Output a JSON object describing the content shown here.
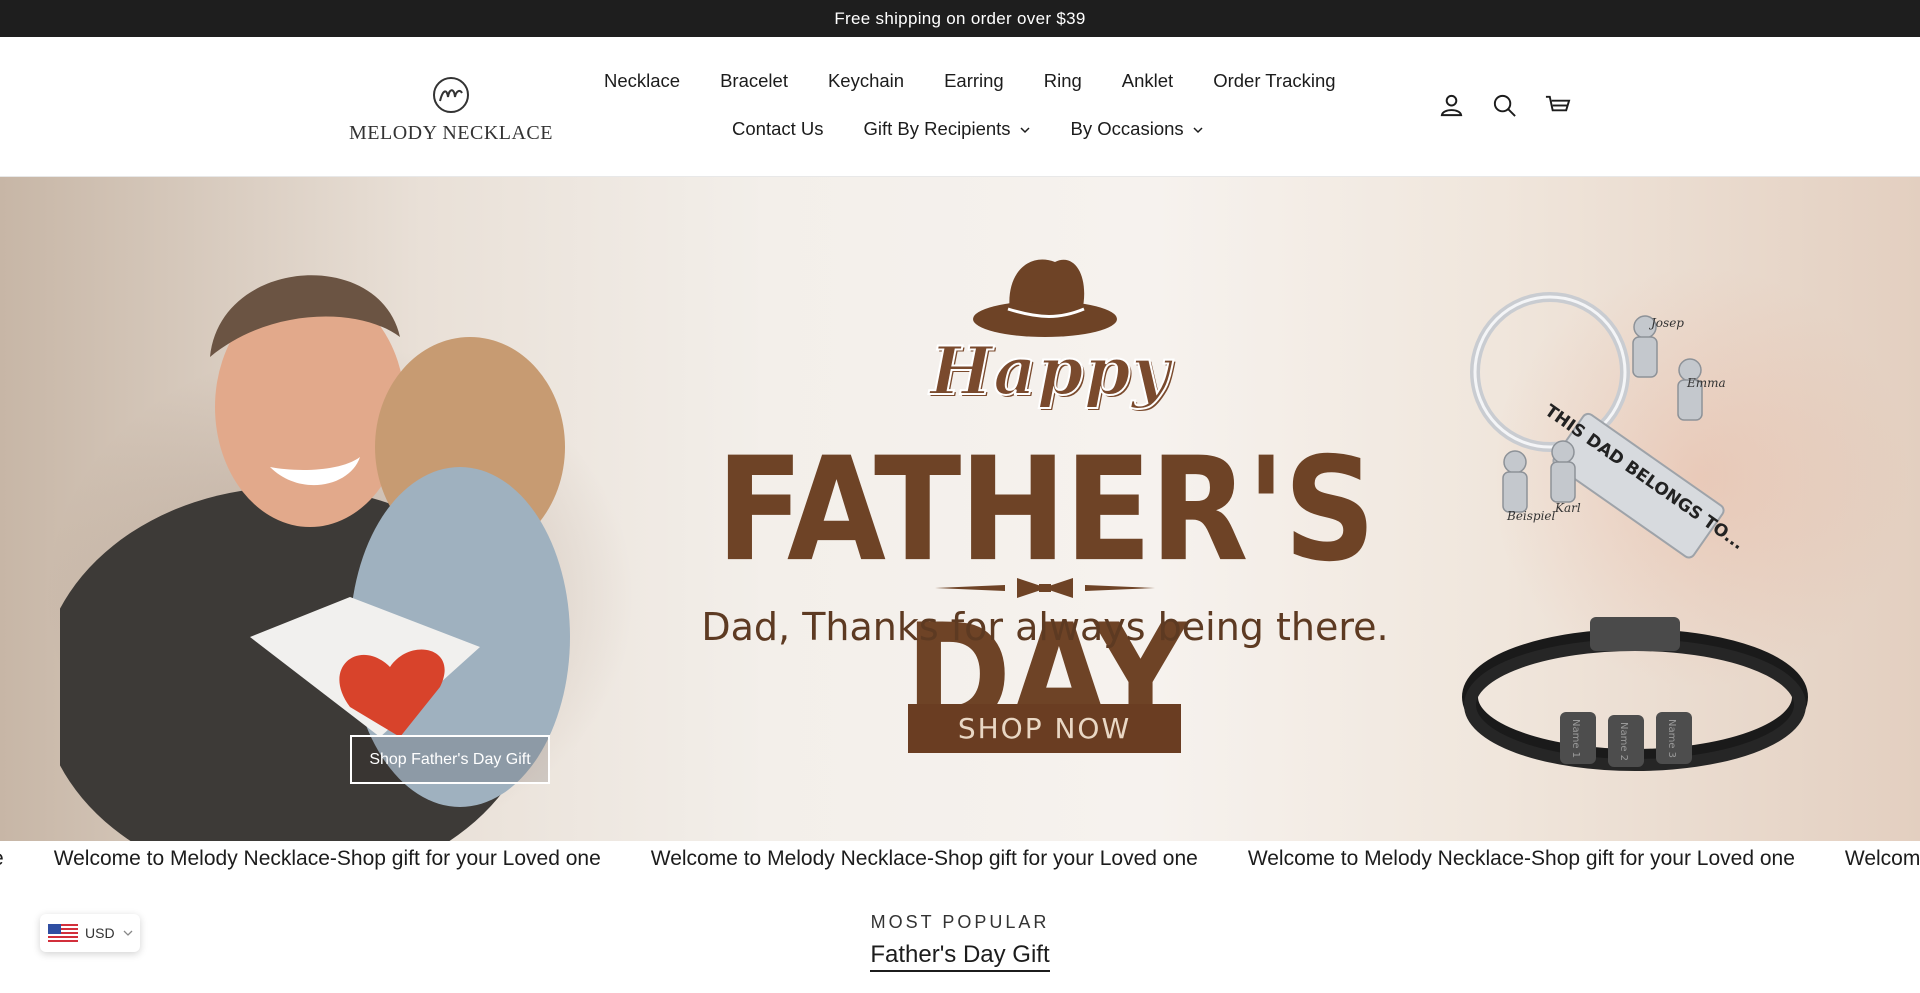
{
  "announcement": {
    "text": "Free shipping on order over $39"
  },
  "brand": {
    "name": "MELODY NECKLACE"
  },
  "nav": {
    "row1": [
      "Necklace",
      "Bracelet",
      "Keychain",
      "Earring",
      "Ring",
      "Anklet",
      "Order Tracking"
    ],
    "row2": [
      {
        "label": "Contact Us",
        "dropdown": false
      },
      {
        "label": "Gift By Recipients",
        "dropdown": true
      },
      {
        "label": "By Occasions",
        "dropdown": true
      }
    ]
  },
  "header_icons": [
    "account-icon",
    "search-icon",
    "cart-icon"
  ],
  "hero": {
    "happy": "Happy",
    "headline": "FATHER'S DAY",
    "tagline": "Dad, Thanks for always being there.",
    "shop_now": "SHOP NOW",
    "cta": "Shop Father's Day Gift",
    "keychain_names": [
      "Josep",
      "Emma",
      "Beispiel",
      "Karl"
    ],
    "keychain_tag": "THIS DAD BELONGS TO...",
    "bracelet_beads": [
      "Name 1",
      "Name 2",
      "Name 3"
    ],
    "colors": {
      "brown": "#6e4326",
      "shop_now_bg": "#6a3d22"
    }
  },
  "marquee": {
    "items": [
      "e",
      "Welcome to Melody Necklace-Shop gift for your Loved one",
      "Welcome to Melody Necklace-Shop gift for your Loved one",
      "Welcome to Melody Necklace-Shop gift for your Loved one",
      "Welcome to Mel"
    ]
  },
  "section": {
    "eyebrow": "MOST POPULAR",
    "title": "Father's Day Gift"
  },
  "currency": {
    "code": "USD",
    "flag": "us-flag-icon"
  }
}
